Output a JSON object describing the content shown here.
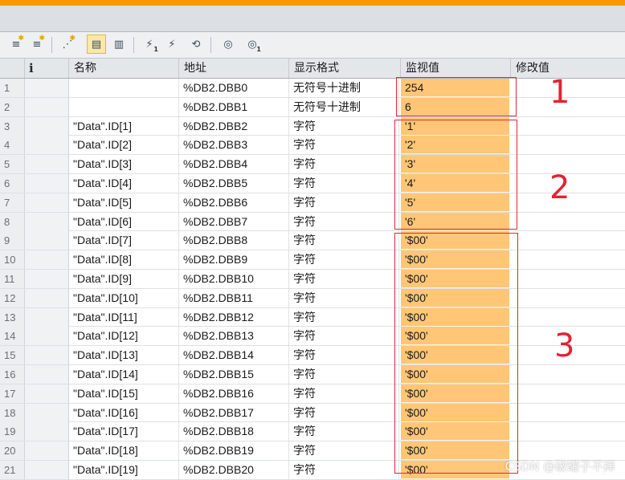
{
  "toolbar": {
    "buttons": [
      {
        "icon": "insert-row-icon"
      },
      {
        "icon": "add-row-icon"
      },
      {
        "icon": "insert-comment-row-icon"
      },
      {
        "icon": "show-hide-modify-columns-icon"
      },
      {
        "icon": "show-hide-advanced-columns-icon"
      },
      {
        "icon": "modify-now-icon",
        "sub": "1"
      },
      {
        "icon": "modify-with-trigger-icon"
      },
      {
        "icon": "enable-peripheral-outputs-icon"
      },
      {
        "icon": "monitor-all-icon"
      },
      {
        "icon": "monitor-once-icon",
        "sub": "1"
      }
    ]
  },
  "table": {
    "headers": {
      "number": "",
      "info": "i",
      "name": "名称",
      "address": "地址",
      "display_format": "显示格式",
      "monitor_value": "监视值",
      "modify_value": "修改值"
    },
    "rows": [
      {
        "num": "1",
        "name": "",
        "addr": "%DB2.DBB0",
        "fmt": "无符号十进制",
        "mon": "254",
        "mod": ""
      },
      {
        "num": "2",
        "name": "",
        "addr": "%DB2.DBB1",
        "fmt": "无符号十进制",
        "mon": "6",
        "mod": ""
      },
      {
        "num": "3",
        "name": "\"Data\".ID[1]",
        "addr": "%DB2.DBB2",
        "fmt": "字符",
        "mon": "'1'",
        "mod": ""
      },
      {
        "num": "4",
        "name": "\"Data\".ID[2]",
        "addr": "%DB2.DBB3",
        "fmt": "字符",
        "mon": "'2'",
        "mod": ""
      },
      {
        "num": "5",
        "name": "\"Data\".ID[3]",
        "addr": "%DB2.DBB4",
        "fmt": "字符",
        "mon": "'3'",
        "mod": ""
      },
      {
        "num": "6",
        "name": "\"Data\".ID[4]",
        "addr": "%DB2.DBB5",
        "fmt": "字符",
        "mon": "'4'",
        "mod": ""
      },
      {
        "num": "7",
        "name": "\"Data\".ID[5]",
        "addr": "%DB2.DBB6",
        "fmt": "字符",
        "mon": "'5'",
        "mod": ""
      },
      {
        "num": "8",
        "name": "\"Data\".ID[6]",
        "addr": "%DB2.DBB7",
        "fmt": "字符",
        "mon": "'6'",
        "mod": ""
      },
      {
        "num": "9",
        "name": "\"Data\".ID[7]",
        "addr": "%DB2.DBB8",
        "fmt": "字符",
        "mon": "'$00'",
        "mod": ""
      },
      {
        "num": "10",
        "name": "\"Data\".ID[8]",
        "addr": "%DB2.DBB9",
        "fmt": "字符",
        "mon": "'$00'",
        "mod": ""
      },
      {
        "num": "11",
        "name": "\"Data\".ID[9]",
        "addr": "%DB2.DBB10",
        "fmt": "字符",
        "mon": "'$00'",
        "mod": ""
      },
      {
        "num": "12",
        "name": "\"Data\".ID[10]",
        "addr": "%DB2.DBB11",
        "fmt": "字符",
        "mon": "'$00'",
        "mod": ""
      },
      {
        "num": "13",
        "name": "\"Data\".ID[11]",
        "addr": "%DB2.DBB12",
        "fmt": "字符",
        "mon": "'$00'",
        "mod": ""
      },
      {
        "num": "14",
        "name": "\"Data\".ID[12]",
        "addr": "%DB2.DBB13",
        "fmt": "字符",
        "mon": "'$00'",
        "mod": ""
      },
      {
        "num": "15",
        "name": "\"Data\".ID[13]",
        "addr": "%DB2.DBB14",
        "fmt": "字符",
        "mon": "'$00'",
        "mod": ""
      },
      {
        "num": "16",
        "name": "\"Data\".ID[14]",
        "addr": "%DB2.DBB15",
        "fmt": "字符",
        "mon": "'$00'",
        "mod": ""
      },
      {
        "num": "17",
        "name": "\"Data\".ID[15]",
        "addr": "%DB2.DBB16",
        "fmt": "字符",
        "mon": "'$00'",
        "mod": ""
      },
      {
        "num": "18",
        "name": "\"Data\".ID[16]",
        "addr": "%DB2.DBB17",
        "fmt": "字符",
        "mon": "'$00'",
        "mod": ""
      },
      {
        "num": "19",
        "name": "\"Data\".ID[17]",
        "addr": "%DB2.DBB18",
        "fmt": "字符",
        "mon": "'$00'",
        "mod": ""
      },
      {
        "num": "20",
        "name": "\"Data\".ID[18]",
        "addr": "%DB2.DBB19",
        "fmt": "字符",
        "mon": "'$00'",
        "mod": ""
      },
      {
        "num": "21",
        "name": "\"Data\".ID[19]",
        "addr": "%DB2.DBB20",
        "fmt": "字符",
        "mon": "'$00'",
        "mod": ""
      }
    ]
  },
  "annotations": {
    "label_1": "1",
    "label_2": "2",
    "label_3": "3",
    "box_color": "#e0283a"
  },
  "colors": {
    "accent_bar": "#f59a00",
    "monitor_cell": "#fec676"
  },
  "watermark": "CSDN @破罐子不摔"
}
